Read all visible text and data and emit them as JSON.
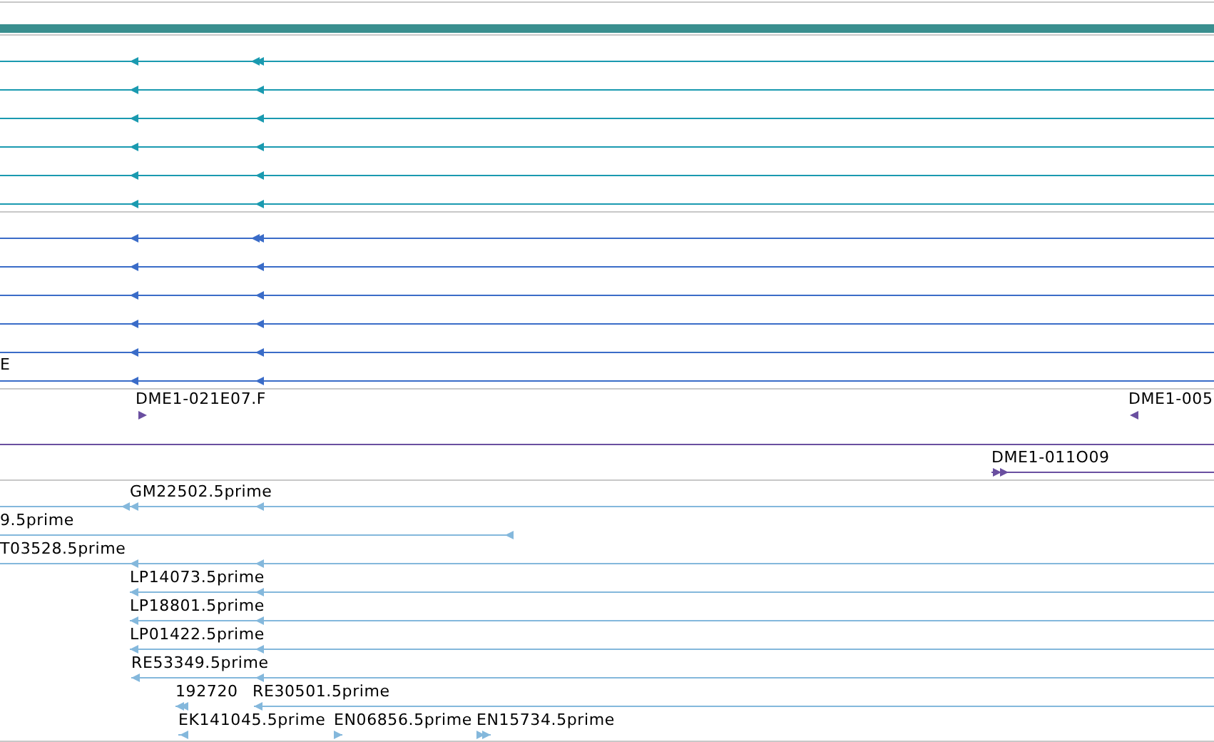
{
  "tracks": [
    {
      "kind": "lines",
      "color": "#1a9ab0",
      "features": [
        {
          "reverse": true
        },
        {
          "reverse": true
        },
        {
          "reverse": true
        },
        {
          "reverse": true
        },
        {
          "reverse": true
        },
        {
          "reverse": true
        }
      ]
    },
    {
      "kind": "lines",
      "color": "#3a6cc8",
      "features": [
        {
          "reverse": true
        },
        {
          "reverse": true
        },
        {
          "reverse": true
        },
        {
          "reverse": true
        },
        {
          "reverse": true
        },
        {
          "reverse": true,
          "label": "E"
        }
      ]
    },
    {
      "kind": "clones",
      "color": "#6a4fa0",
      "features": [
        {
          "label": "DME1-021E07.F",
          "reverse": false
        },
        {
          "label": "DME1-005",
          "reverse": true
        },
        {
          "label": "DME1-011O09",
          "reverse": false
        }
      ]
    },
    {
      "kind": "ests",
      "color": "#84b8dc",
      "features": [
        {
          "label": "GM22502.5prime",
          "reverse": true
        },
        {
          "label": "9.5prime",
          "reverse": true
        },
        {
          "label": "T03528.5prime",
          "reverse": true
        },
        {
          "label": "LP14073.5prime",
          "reverse": true
        },
        {
          "label": "LP18801.5prime",
          "reverse": true
        },
        {
          "label": "LP01422.5prime",
          "reverse": true
        },
        {
          "label": "RE53349.5prime",
          "reverse": true
        },
        {
          "label": "192720",
          "reverse": true
        },
        {
          "label": "RE30501.5prime",
          "reverse": true
        },
        {
          "label": "EK141045.5prime",
          "reverse": true
        },
        {
          "label": "EN06856.5prime",
          "reverse": false
        },
        {
          "label": "EN15734.5prime",
          "reverse": false
        }
      ]
    }
  ]
}
